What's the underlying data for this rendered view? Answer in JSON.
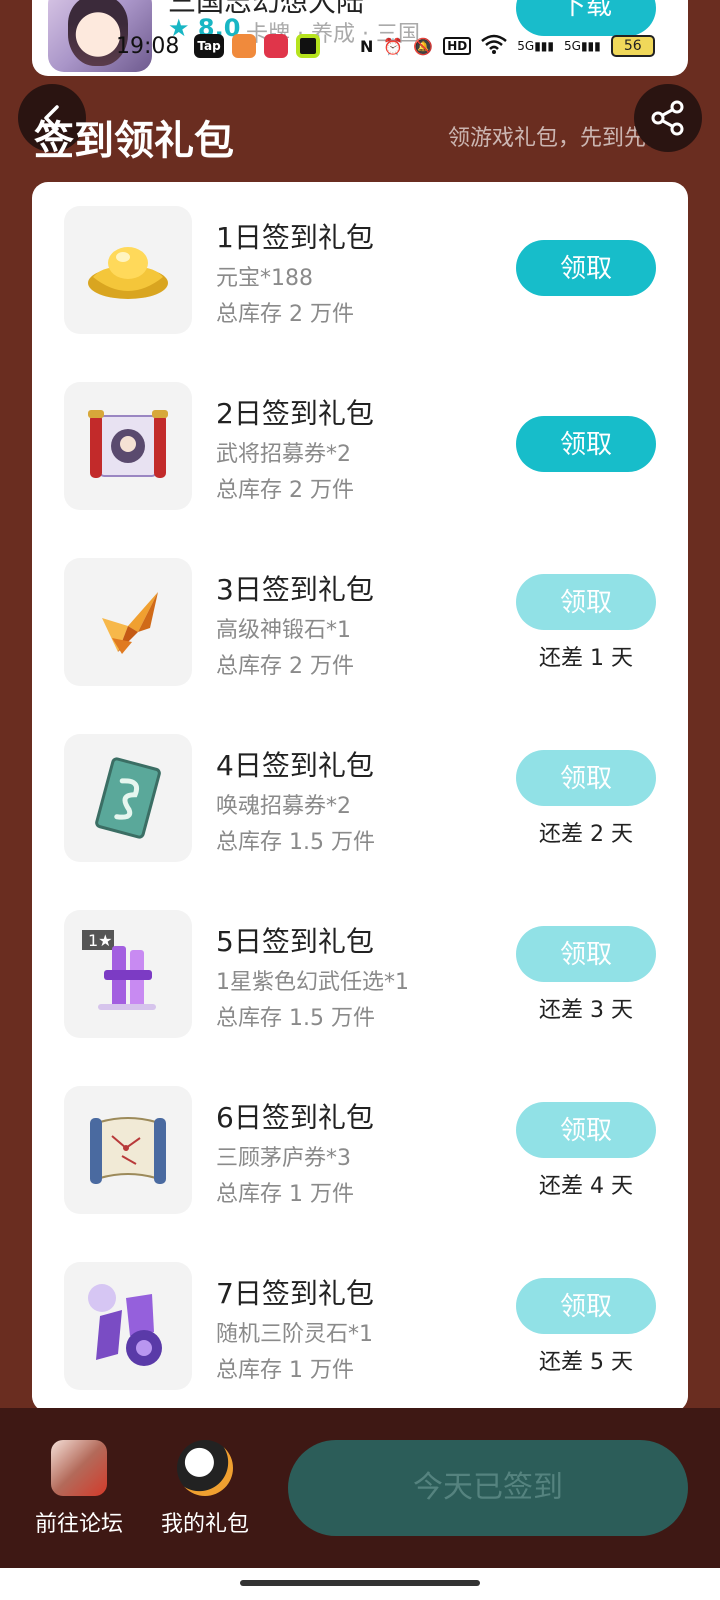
{
  "app_banner": {
    "name": "三国志幻想大陆",
    "rating": "8.0",
    "tags": "卡牌 · 养成 · 三国",
    "download_label": "下载"
  },
  "status_bar": {
    "time": "19:08",
    "battery": "56",
    "network_1": "5G",
    "network_2": "5G"
  },
  "header": {
    "title": "签到领礼包",
    "subtitle": "领游戏礼包，先到先得"
  },
  "gifts": [
    {
      "title": "1日签到礼包",
      "desc": "元宝*188",
      "stock": "总库存 2 万件",
      "button": "领取",
      "state": "active",
      "days_left": ""
    },
    {
      "title": "2日签到礼包",
      "desc": "武将招募券*2",
      "stock": "总库存 2 万件",
      "button": "领取",
      "state": "active",
      "days_left": ""
    },
    {
      "title": "3日签到礼包",
      "desc": "高级神锻石*1",
      "stock": "总库存 2 万件",
      "button": "领取",
      "state": "disabled",
      "days_left": "还差 1 天"
    },
    {
      "title": "4日签到礼包",
      "desc": "唤魂招募券*2",
      "stock": "总库存 1.5 万件",
      "button": "领取",
      "state": "disabled",
      "days_left": "还差 2 天"
    },
    {
      "title": "5日签到礼包",
      "desc": "1星紫色幻武任选*1",
      "stock": "总库存 1.5 万件",
      "button": "领取",
      "state": "disabled",
      "days_left": "还差 3 天"
    },
    {
      "title": "6日签到礼包",
      "desc": "三顾茅庐券*3",
      "stock": "总库存 1 万件",
      "button": "领取",
      "state": "disabled",
      "days_left": "还差 4 天"
    },
    {
      "title": "7日签到礼包",
      "desc": "随机三阶灵石*1",
      "stock": "总库存 1 万件",
      "button": "领取",
      "state": "disabled",
      "days_left": "还差 5 天"
    }
  ],
  "bottom_bar": {
    "forum_label": "前往论坛",
    "my_gifts_label": "我的礼包",
    "signed_label": "今天已签到"
  },
  "colors": {
    "background": "#6a2d20",
    "accent": "#17bdca",
    "accent_disabled": "#91e1e6",
    "bottom_bar": "#3e1814"
  }
}
